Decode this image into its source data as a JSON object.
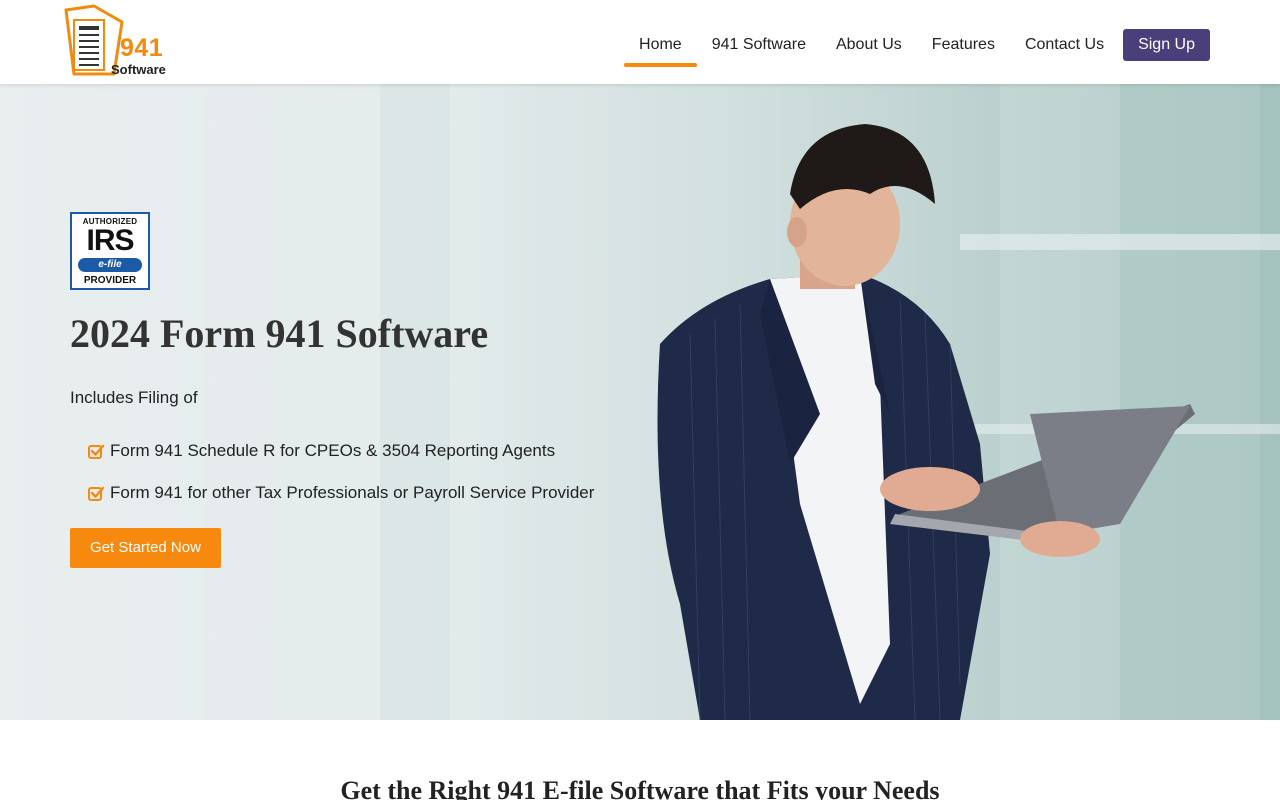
{
  "logo": {
    "number": "941",
    "subtitle": "Software",
    "icon": "document-logo-icon"
  },
  "nav": {
    "items": [
      {
        "label": "Home",
        "active": true
      },
      {
        "label": "941 Software",
        "active": false
      },
      {
        "label": "About Us",
        "active": false
      },
      {
        "label": "Features",
        "active": false
      },
      {
        "label": "Contact Us",
        "active": false
      }
    ],
    "signup_label": "Sign Up"
  },
  "hero": {
    "badge": {
      "top": "AUTHORIZED",
      "main": "IRS",
      "efile": "e-file",
      "bottom": "PROVIDER"
    },
    "title": "2024 Form 941 Software",
    "subtitle": "Includes Filing of",
    "features": [
      "Form 941 Schedule R for CPEOs & 3504 Reporting Agents",
      "Form 941 for other Tax Professionals or Payroll Service Provider"
    ],
    "cta_label": "Get Started Now"
  },
  "section": {
    "title": "Get the Right 941 E-file Software that Fits your Needs"
  },
  "colors": {
    "accent": "#f7890f",
    "signup": "#4a3f7a",
    "irs_blue": "#1a5aa6"
  }
}
